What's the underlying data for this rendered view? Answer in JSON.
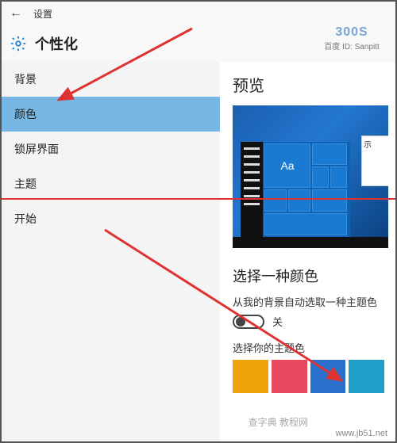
{
  "titlebar": {
    "label": "设置"
  },
  "header": {
    "title": "个性化"
  },
  "sidebar": {
    "items": [
      {
        "label": "背景"
      },
      {
        "label": "颜色"
      },
      {
        "label": "锁屏界面"
      },
      {
        "label": "主题"
      },
      {
        "label": "开始"
      }
    ],
    "selected_index": 1
  },
  "content": {
    "preview_title": "预览",
    "preview_tile_text": "Aa",
    "preview_window_hint": "示",
    "choose_color_title": "选择一种颜色",
    "auto_pick_label": "从我的背景自动选取一种主题色",
    "toggle": {
      "state": "off",
      "off_label": "关"
    },
    "choose_theme_label": "选择你的主题色",
    "swatches": [
      "#f0a30a",
      "#e8495f",
      "#2a6fc9",
      "#20a0c8"
    ]
  },
  "watermark": {
    "logo": "300S",
    "line": "百度 ID: Sanpitt",
    "footer1": "www.jb51.net",
    "footer2": "查字典 教程网"
  }
}
